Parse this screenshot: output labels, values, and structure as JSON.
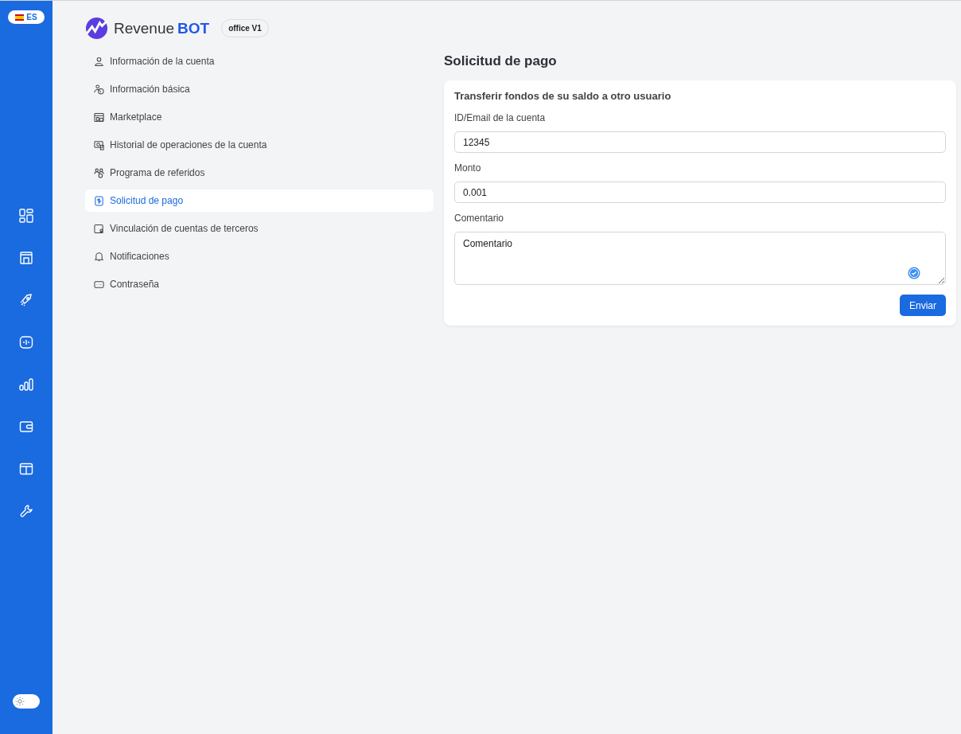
{
  "language": {
    "code": "ES"
  },
  "theme": {
    "dark": false
  },
  "rail": [
    {
      "kind": "dashboard"
    },
    {
      "kind": "store"
    },
    {
      "kind": "rocket"
    },
    {
      "kind": "signal"
    },
    {
      "kind": "bars"
    },
    {
      "kind": "wallet"
    },
    {
      "kind": "box"
    },
    {
      "kind": "wrench"
    }
  ],
  "brand": {
    "name": "Revenue",
    "name_bold": "BOT",
    "badge": "office V1"
  },
  "menu": [
    {
      "label": "Información de la cuenta",
      "kind": "user",
      "selected": false
    },
    {
      "label": "Información básica",
      "kind": "info",
      "selected": false
    },
    {
      "label": "Marketplace",
      "kind": "store",
      "selected": false
    },
    {
      "label": "Historial de operaciones de la cuenta",
      "kind": "history",
      "selected": false
    },
    {
      "label": "Programa de referidos",
      "kind": "people",
      "selected": false
    },
    {
      "label": "Solicitud de pago",
      "kind": "payment",
      "selected": true
    },
    {
      "label": "Vinculación de cuentas de terceros",
      "kind": "link",
      "selected": false
    },
    {
      "label": "Notificaciones",
      "kind": "bell",
      "selected": false
    },
    {
      "label": "Contraseña",
      "kind": "password",
      "selected": false
    }
  ],
  "page_title": "Solicitud de pago",
  "form": {
    "title": "Transferir fondos de su saldo a otro usuario",
    "fields": [
      {
        "label": "ID/Email de la cuenta",
        "value": "12345",
        "kind": "input"
      },
      {
        "label": "Monto",
        "value": "0.001",
        "kind": "input"
      },
      {
        "label": "Comentario",
        "value": "Comentario",
        "kind": "textarea"
      }
    ],
    "submit": "Enviar"
  }
}
